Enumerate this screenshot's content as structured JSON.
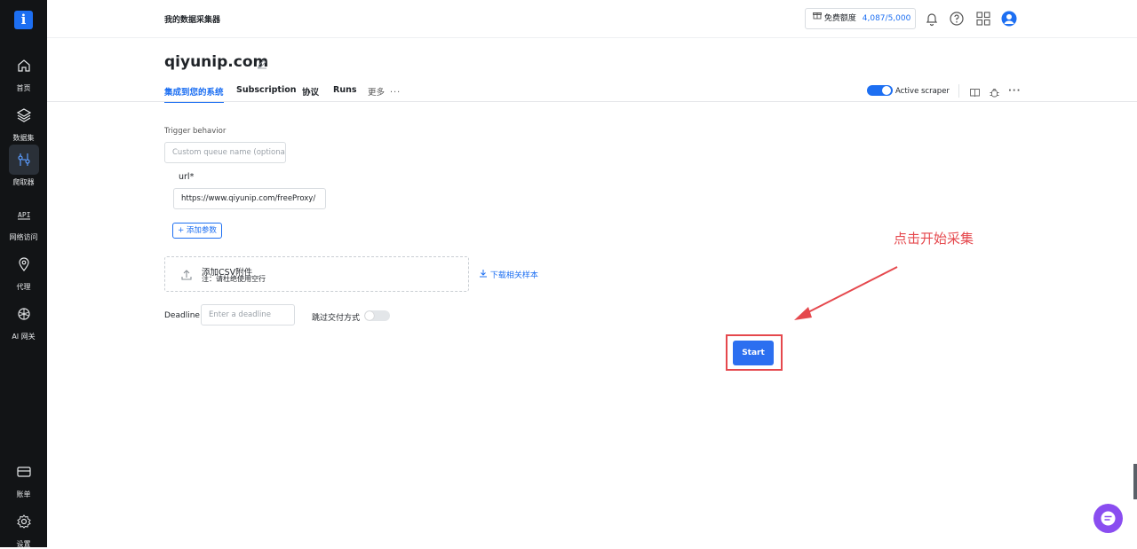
{
  "sidebar": {
    "logo": "i",
    "items": [
      {
        "label": "首页",
        "icon": "home-icon"
      },
      {
        "label": "数据集",
        "icon": "layers-icon"
      },
      {
        "label": "爬取器",
        "icon": "scraper-icon",
        "active": true
      },
      {
        "label": "网络访问",
        "icon": "api-icon"
      },
      {
        "label": "代理",
        "icon": "location-pin-icon"
      },
      {
        "label": "AI 网关",
        "icon": "brain-icon"
      }
    ],
    "bottom_items": [
      {
        "label": "账单",
        "icon": "billing-card-icon"
      },
      {
        "label": "设置",
        "icon": "gear-icon"
      }
    ]
  },
  "header": {
    "brand": "我的数据采集器",
    "quota_label": "免费额度",
    "quota_value": "4,087/5,000"
  },
  "page": {
    "title": "qiyunip.com",
    "tabs": [
      {
        "label": "集成到您的系统",
        "active": true
      },
      {
        "label": "Subscription"
      },
      {
        "label": "协议"
      },
      {
        "label": "Runs"
      },
      {
        "label": "更多"
      }
    ],
    "active_scraper_label": "Active scraper",
    "active_scraper_on": true
  },
  "form": {
    "trigger_behavior_label": "Trigger behavior",
    "queue_placeholder": "Custom queue name (optional)",
    "url_label": "url*",
    "url_value": "https://www.qiyunip.com/freeProxy/",
    "add_param_label": "+ 添加参数",
    "csv_title": "添加CSV附件",
    "csv_note": "注：请杜绝使用空行",
    "download_sample_label": "下载相关样本",
    "deadline_label": "Deadline",
    "deadline_placeholder": "Enter a deadline",
    "skip_delivery_label": "跳过交付方式",
    "skip_delivery_on": false,
    "start_label": "Start"
  },
  "annotation": {
    "text": "点击开始采集",
    "color": "#e5484d"
  },
  "colors": {
    "accent": "#1d6ff2",
    "sidebar_bg": "#121416",
    "annotation_red": "#e5484d"
  }
}
